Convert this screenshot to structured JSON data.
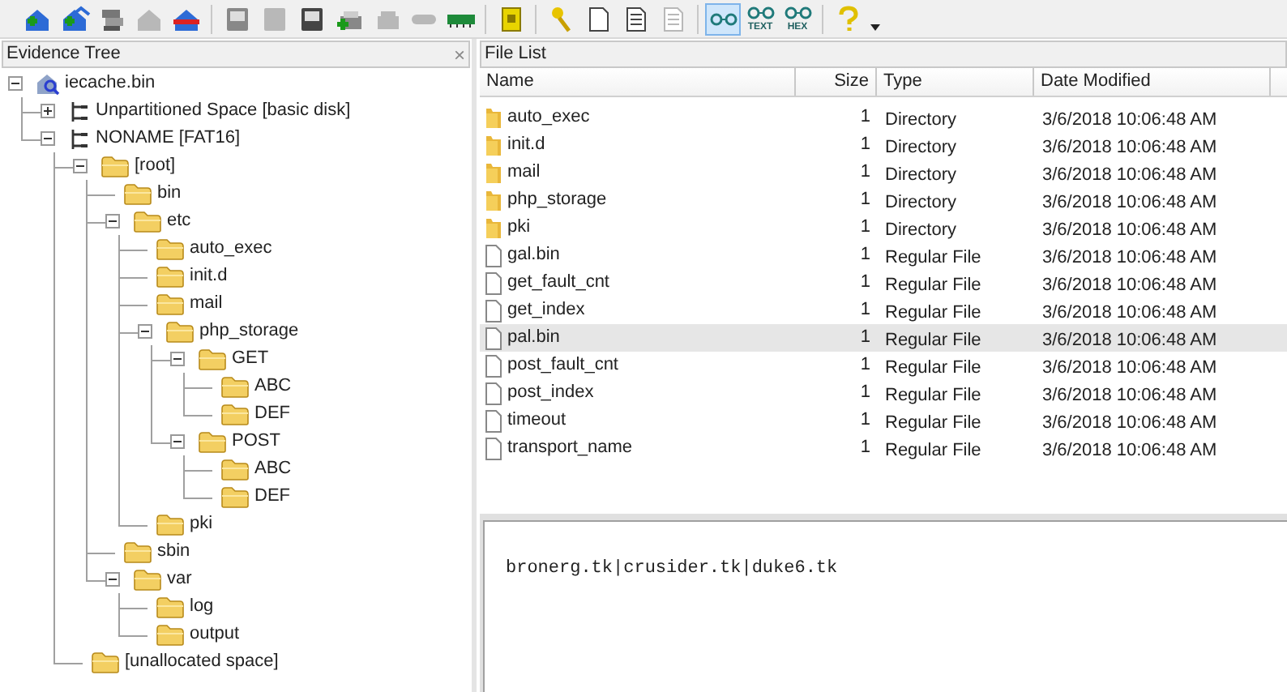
{
  "toolbar": {
    "buttons": [
      {
        "kind": "house",
        "disabled": false,
        "selected": false
      },
      {
        "kind": "houses",
        "disabled": false,
        "selected": false
      },
      {
        "kind": "stack",
        "disabled": false,
        "selected": false
      },
      {
        "kind": "house",
        "disabled": true,
        "selected": false
      },
      {
        "kind": "house-x",
        "disabled": false,
        "selected": false
      },
      {
        "kind": "sep"
      },
      {
        "kind": "disk",
        "disabled": false,
        "selected": false
      },
      {
        "kind": "floppy",
        "disabled": true,
        "selected": false
      },
      {
        "kind": "card",
        "disabled": false,
        "selected": false
      },
      {
        "kind": "printer-plus",
        "disabled": false,
        "selected": false
      },
      {
        "kind": "printer",
        "disabled": true,
        "selected": false
      },
      {
        "kind": "tape",
        "disabled": true,
        "selected": false
      },
      {
        "kind": "chip",
        "disabled": false,
        "selected": false
      },
      {
        "kind": "sep"
      },
      {
        "kind": "notebook",
        "disabled": false,
        "selected": false
      },
      {
        "kind": "sep"
      },
      {
        "kind": "key",
        "disabled": false,
        "selected": false
      },
      {
        "kind": "page",
        "disabled": false,
        "selected": false
      },
      {
        "kind": "page-lines",
        "disabled": false,
        "selected": false
      },
      {
        "kind": "page-lines",
        "disabled": true,
        "selected": false
      },
      {
        "kind": "sep"
      },
      {
        "kind": "glasses",
        "disabled": false,
        "selected": true
      },
      {
        "kind": "glasses",
        "label": "TEXT",
        "disabled": false,
        "selected": false
      },
      {
        "kind": "glasses",
        "label": "HEX",
        "disabled": false,
        "selected": false
      },
      {
        "kind": "sep"
      },
      {
        "kind": "help",
        "disabled": false,
        "selected": false
      },
      {
        "kind": "caret"
      }
    ]
  },
  "evidence_tree": {
    "title": "Evidence Tree",
    "close": "×",
    "items": [
      {
        "label": "iecache.bin",
        "kind": "image",
        "expanded": true,
        "children": [
          {
            "label": "Unpartitioned Space [basic disk]",
            "kind": "partition",
            "expanded": false
          },
          {
            "label": "NONAME [FAT16]",
            "kind": "partition",
            "expanded": true,
            "children": [
              {
                "label": "[root]",
                "kind": "folder",
                "expanded": true,
                "children": [
                  {
                    "label": "bin",
                    "kind": "folder"
                  },
                  {
                    "label": "etc",
                    "kind": "folder",
                    "expanded": true,
                    "children": [
                      {
                        "label": "auto_exec",
                        "kind": "folder"
                      },
                      {
                        "label": "init.d",
                        "kind": "folder"
                      },
                      {
                        "label": "mail",
                        "kind": "folder"
                      },
                      {
                        "label": "php_storage",
                        "kind": "folder",
                        "expanded": true,
                        "children": [
                          {
                            "label": "GET",
                            "kind": "folder",
                            "expanded": true,
                            "children": [
                              {
                                "label": "ABC",
                                "kind": "folder"
                              },
                              {
                                "label": "DEF",
                                "kind": "folder"
                              }
                            ]
                          },
                          {
                            "label": "POST",
                            "kind": "folder",
                            "expanded": true,
                            "children": [
                              {
                                "label": "ABC",
                                "kind": "folder"
                              },
                              {
                                "label": "DEF",
                                "kind": "folder"
                              }
                            ]
                          }
                        ]
                      },
                      {
                        "label": "pki",
                        "kind": "folder"
                      }
                    ]
                  },
                  {
                    "label": "sbin",
                    "kind": "folder"
                  },
                  {
                    "label": "var",
                    "kind": "folder",
                    "expanded": true,
                    "children": [
                      {
                        "label": "log",
                        "kind": "folder"
                      },
                      {
                        "label": "output",
                        "kind": "folder"
                      }
                    ]
                  }
                ]
              },
              {
                "label": "[unallocated space]",
                "kind": "folder"
              }
            ]
          }
        ]
      }
    ]
  },
  "file_list": {
    "title": "File List",
    "columns": [
      "Name",
      "Size",
      "Type",
      "Date Modified"
    ],
    "rows": [
      {
        "kind": "folder",
        "selected": false,
        "cells": [
          "auto_exec",
          "1",
          "Directory",
          "3/6/2018 10:06:48 AM"
        ]
      },
      {
        "kind": "folder",
        "selected": false,
        "cells": [
          "init.d",
          "1",
          "Directory",
          "3/6/2018 10:06:48 AM"
        ]
      },
      {
        "kind": "folder",
        "selected": false,
        "cells": [
          "mail",
          "1",
          "Directory",
          "3/6/2018 10:06:48 AM"
        ]
      },
      {
        "kind": "folder",
        "selected": false,
        "cells": [
          "php_storage",
          "1",
          "Directory",
          "3/6/2018 10:06:48 AM"
        ]
      },
      {
        "kind": "folder",
        "selected": false,
        "cells": [
          "pki",
          "1",
          "Directory",
          "3/6/2018 10:06:48 AM"
        ]
      },
      {
        "kind": "file",
        "selected": false,
        "cells": [
          "gal.bin",
          "1",
          "Regular File",
          "3/6/2018 10:06:48 AM"
        ]
      },
      {
        "kind": "file",
        "selected": false,
        "cells": [
          "get_fault_cnt",
          "1",
          "Regular File",
          "3/6/2018 10:06:48 AM"
        ]
      },
      {
        "kind": "file",
        "selected": false,
        "cells": [
          "get_index",
          "1",
          "Regular File",
          "3/6/2018 10:06:48 AM"
        ]
      },
      {
        "kind": "file",
        "selected": true,
        "cells": [
          "pal.bin",
          "1",
          "Regular File",
          "3/6/2018 10:06:48 AM"
        ]
      },
      {
        "kind": "file",
        "selected": false,
        "cells": [
          "post_fault_cnt",
          "1",
          "Regular File",
          "3/6/2018 10:06:48 AM"
        ]
      },
      {
        "kind": "file",
        "selected": false,
        "cells": [
          "post_index",
          "1",
          "Regular File",
          "3/6/2018 10:06:48 AM"
        ]
      },
      {
        "kind": "file",
        "selected": false,
        "cells": [
          "timeout",
          "1",
          "Regular File",
          "3/6/2018 10:06:48 AM"
        ]
      },
      {
        "kind": "file",
        "selected": false,
        "cells": [
          "transport_name",
          "1",
          "Regular File",
          "3/6/2018 10:06:48 AM"
        ]
      }
    ]
  },
  "viewer": {
    "content": "bronerg.tk|crusider.tk|duke6.tk"
  }
}
